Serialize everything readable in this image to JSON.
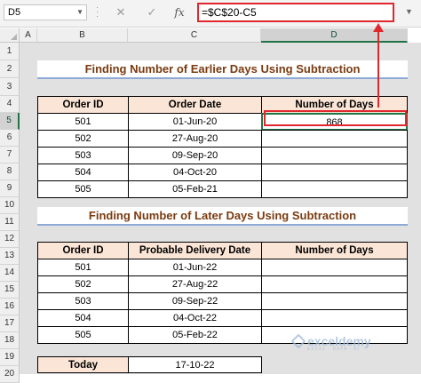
{
  "formula_bar": {
    "name_box": "D5",
    "cancel_icon": "✕",
    "enter_icon": "✓",
    "fx_label": "fx",
    "formula": "=$C$20-C5"
  },
  "columns": [
    "A",
    "B",
    "C",
    "D"
  ],
  "rows": [
    "1",
    "2",
    "3",
    "4",
    "5",
    "6",
    "7",
    "8",
    "9",
    "10",
    "11",
    "12",
    "13",
    "14",
    "15",
    "16",
    "17",
    "18",
    "19",
    "20"
  ],
  "selected_cell": "D5",
  "table1": {
    "title": "Finding Number of Earlier Days Using Subtraction",
    "headers": [
      "Order ID",
      "Order Date",
      "Number of Days"
    ],
    "rows": [
      [
        "501",
        "01-Jun-20",
        "868"
      ],
      [
        "502",
        "27-Aug-20",
        ""
      ],
      [
        "503",
        "09-Sep-20",
        ""
      ],
      [
        "504",
        "04-Oct-20",
        ""
      ],
      [
        "505",
        "05-Feb-21",
        ""
      ]
    ]
  },
  "table2": {
    "title": "Finding Number of Later Days Using Subtraction",
    "headers": [
      "Order ID",
      "Probable Delivery Date",
      "Number of Days"
    ],
    "rows": [
      [
        "501",
        "01-Jun-22",
        ""
      ],
      [
        "502",
        "27-Aug-22",
        ""
      ],
      [
        "503",
        "09-Sep-22",
        ""
      ],
      [
        "504",
        "04-Oct-22",
        ""
      ],
      [
        "505",
        "05-Feb-22",
        ""
      ]
    ]
  },
  "today": {
    "label": "Today",
    "value": "17-10-22"
  },
  "watermark": {
    "name": "exceldemy",
    "tagline": "EXCEL · DATA · BI"
  },
  "colors": {
    "accent_red": "#e0272e",
    "excel_green": "#217346",
    "header_fill": "#fbe5d6",
    "title_color": "#7a3b10"
  }
}
